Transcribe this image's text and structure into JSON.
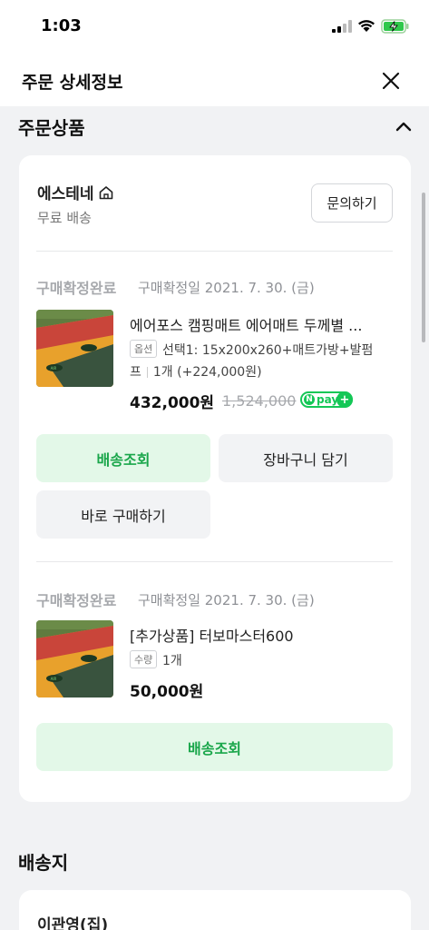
{
  "status_bar": {
    "time": "1:03"
  },
  "header": {
    "title": "주문 상세정보"
  },
  "section_order": {
    "title": "주문상품"
  },
  "store": {
    "name": "에스테네",
    "shipping": "무료 배송",
    "inquiry_label": "문의하기"
  },
  "orders": [
    {
      "status": "구매확정완료",
      "date": "구매확정일 2021. 7. 30. (금)",
      "product_name": "에어포스 캠핑매트 에어매트 두께별 ...",
      "badge": "옵션",
      "option_line1": "선택1: 15x200x260+매트가방+발펌",
      "option_line2": "프",
      "quantity": "1개 (+224,000원)",
      "price": "432,000원",
      "original_price": "1,524,000",
      "npay_label": "pay",
      "btn_delivery": "배송조회",
      "btn_cart": "장바구니 담기",
      "btn_buy": "바로 구매하기"
    },
    {
      "status": "구매확정완료",
      "date": "구매확정일 2021. 7. 30. (금)",
      "product_name": "[추가상품] 터보마스터600",
      "badge": "수량",
      "quantity": "1개",
      "price": "50,000원",
      "btn_delivery": "배송조회"
    }
  ],
  "section_shipping": {
    "title": "배송지",
    "recipient": "이관영(집)"
  },
  "colors": {
    "accent_green": "#19a64a",
    "green_bg": "#e3f8e8",
    "page_bg": "#f1f2f4"
  },
  "icons": [
    "signal-icon",
    "wifi-icon",
    "battery-charging-icon",
    "close-icon",
    "chevron-up-icon",
    "home-icon",
    "npay-logo"
  ]
}
